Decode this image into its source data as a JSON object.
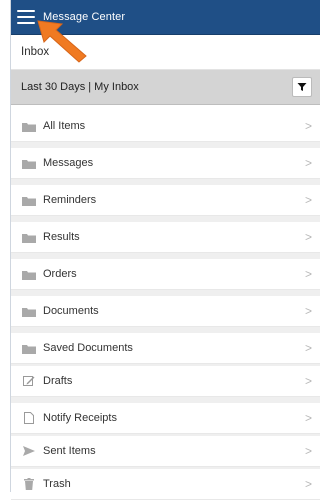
{
  "header": {
    "title": "Message Center"
  },
  "inbox_label": "Inbox",
  "filter": {
    "text": "Last 30 Days | My Inbox"
  },
  "items": [
    {
      "label": "All Items",
      "icon": "folder-icon"
    },
    {
      "label": "Messages",
      "icon": "folder-icon"
    },
    {
      "label": "Reminders",
      "icon": "folder-icon"
    },
    {
      "label": "Results",
      "icon": "folder-icon"
    },
    {
      "label": "Orders",
      "icon": "folder-icon"
    },
    {
      "label": "Documents",
      "icon": "folder-icon"
    },
    {
      "label": "Saved Documents",
      "icon": "folder-icon"
    },
    {
      "label": "Drafts",
      "icon": "edit-icon"
    },
    {
      "label": "Notify Receipts",
      "icon": "document-icon"
    },
    {
      "label": "Sent Items",
      "icon": "send-icon"
    },
    {
      "label": "Trash",
      "icon": "trash-icon"
    }
  ],
  "colors": {
    "header": "#1f4f86",
    "arrow": "#f07a22"
  }
}
